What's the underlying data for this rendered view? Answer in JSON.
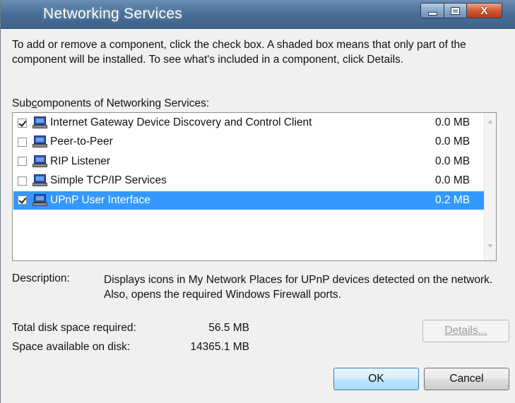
{
  "window": {
    "title": "Networking Services"
  },
  "caption_buttons": {
    "minimize_icon": "minimize-icon",
    "maximize_icon": "maximize-icon",
    "close_icon": "close-icon",
    "close_glyph": "X"
  },
  "intro_text": "To add or remove a component, click the check box. A shaded box means that only part of the component will be installed. To see what's included in a component, click Details.",
  "subcomponents": {
    "label_prefix": "Sub",
    "label_underlined": "c",
    "label_suffix": "omponents of Networking Services:",
    "items": [
      {
        "name": "Internet Gateway Device Discovery and Control Client",
        "size": "0.0 MB",
        "checked": true,
        "selected": false,
        "icon": "computer-icon"
      },
      {
        "name": "Peer-to-Peer",
        "size": "0.0 MB",
        "checked": false,
        "selected": false,
        "icon": "computer-icon"
      },
      {
        "name": "RIP Listener",
        "size": "0.0 MB",
        "checked": false,
        "selected": false,
        "icon": "computer-icon"
      },
      {
        "name": "Simple TCP/IP Services",
        "size": "0.0 MB",
        "checked": false,
        "selected": false,
        "icon": "computer-icon"
      },
      {
        "name": "UPnP User Interface",
        "size": "0.2 MB",
        "checked": true,
        "selected": true,
        "icon": "computer-icon"
      }
    ]
  },
  "description": {
    "label": "Description:",
    "text": "Displays icons in My Network Places for UPnP devices detected on the network. Also, opens the required Windows Firewall ports."
  },
  "disk": {
    "required_label": "Total disk space required:",
    "required_value": "56.5 MB",
    "available_label": "Space available on disk:",
    "available_value": "14365.1 MB"
  },
  "buttons": {
    "details": "Details...",
    "ok": "OK",
    "cancel": "Cancel"
  },
  "colors": {
    "selection": "#3399ff",
    "titlebar": "#4a7099"
  }
}
